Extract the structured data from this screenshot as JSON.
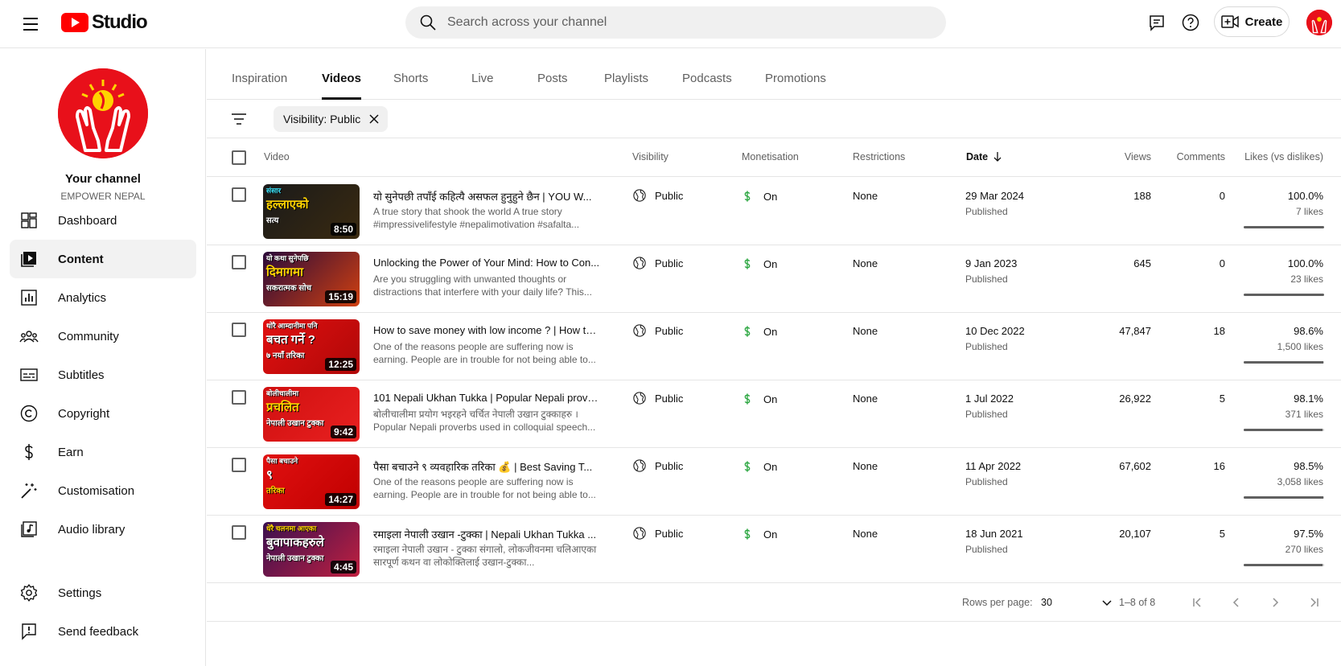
{
  "header": {
    "logo_text": "Studio",
    "search_placeholder": "Search across your channel",
    "create_label": "Create"
  },
  "sidebar": {
    "channel_title": "Your channel",
    "channel_name": "EMPOWER NEPAL",
    "items": [
      {
        "label": "Dashboard",
        "icon": "dashboard-icon"
      },
      {
        "label": "Content",
        "icon": "content-icon",
        "active": true
      },
      {
        "label": "Analytics",
        "icon": "analytics-icon"
      },
      {
        "label": "Community",
        "icon": "community-icon"
      },
      {
        "label": "Subtitles",
        "icon": "subtitles-icon"
      },
      {
        "label": "Copyright",
        "icon": "copyright-icon"
      },
      {
        "label": "Earn",
        "icon": "dollar-icon"
      },
      {
        "label": "Customisation",
        "icon": "magic-wand-icon"
      },
      {
        "label": "Audio library",
        "icon": "audio-library-icon"
      },
      {
        "label": "Settings",
        "icon": "gear-icon"
      },
      {
        "label": "Send feedback",
        "icon": "feedback-icon"
      }
    ]
  },
  "tabs": [
    "Inspiration",
    "Videos",
    "Shorts",
    "Live",
    "Posts",
    "Playlists",
    "Podcasts",
    "Promotions"
  ],
  "active_tab": "Videos",
  "filter": {
    "chip_label": "Visibility: Public"
  },
  "table": {
    "headers": {
      "video": "Video",
      "visibility": "Visibility",
      "monetisation": "Monetisation",
      "restrictions": "Restrictions",
      "date": "Date",
      "views": "Views",
      "comments": "Comments",
      "likes": "Likes (vs dislikes)"
    },
    "rows": [
      {
        "title": "यो सुनेपछी तपाँई कहित्यै असफल हुनुहुने छैन | YOU W...",
        "desc": "A true story that shook the world A true story #impressivelifestyle #nepalimotivation #safalta...",
        "duration": "8:50",
        "visibility": "Public",
        "monetisation": "On",
        "restrictions": "None",
        "date": "29 Mar 2024",
        "status": "Published",
        "views": "188",
        "comments": "0",
        "likes_pct": "100.0%",
        "likes_count": "7 likes",
        "likes_ratio": 1.0
      },
      {
        "title": "Unlocking the Power of Your Mind: How to Con...",
        "desc": "Are you struggling with unwanted thoughts or distractions that interfere with your daily life? This...",
        "duration": "15:19",
        "visibility": "Public",
        "monetisation": "On",
        "restrictions": "None",
        "date": "9 Jan 2023",
        "status": "Published",
        "views": "645",
        "comments": "0",
        "likes_pct": "100.0%",
        "likes_count": "23 likes",
        "likes_ratio": 1.0
      },
      {
        "title": "How to save money with low income ? | How to...",
        "desc": "One of the reasons people are suffering now is earning. People are in trouble for not being able to...",
        "duration": "12:25",
        "visibility": "Public",
        "monetisation": "On",
        "restrictions": "None",
        "date": "10 Dec 2022",
        "status": "Published",
        "views": "47,847",
        "comments": "18",
        "likes_pct": "98.6%",
        "likes_count": "1,500 likes",
        "likes_ratio": 0.986
      },
      {
        "title": "101 Nepali Ukhan Tukka | Popular Nepali prove...",
        "desc": "बोलीचालीमा प्रयोग भइरहने चर्चित नेपाली उखान टुक्काहरु । Popular Nepali proverbs used in colloquial speech...",
        "duration": "9:42",
        "visibility": "Public",
        "monetisation": "On",
        "restrictions": "None",
        "date": "1 Jul 2022",
        "status": "Published",
        "views": "26,922",
        "comments": "5",
        "likes_pct": "98.1%",
        "likes_count": "371 likes",
        "likes_ratio": 0.981
      },
      {
        "title": "पैसा बचाउने ९ व्यवहारिक तरिका 💰 | Best Saving T...",
        "desc": "One of the reasons people are suffering now is earning. People are in trouble for not being able to...",
        "duration": "14:27",
        "visibility": "Public",
        "monetisation": "On",
        "restrictions": "None",
        "date": "11 Apr 2022",
        "status": "Published",
        "views": "67,602",
        "comments": "16",
        "likes_pct": "98.5%",
        "likes_count": "3,058 likes",
        "likes_ratio": 0.985
      },
      {
        "title": "रमाइला नेपाली उखान -टुक्का | Nepali Ukhan Tukka ...",
        "desc": "रमाइला नेपाली उखान - टुक्का संगालो, लोकजीवनमा चलिआएका सारपूर्ण कथन वा लोकोक्तिलाई उखान-टुक्का...",
        "duration": "4:45",
        "visibility": "Public",
        "monetisation": "On",
        "restrictions": "None",
        "date": "18 Jun 2021",
        "status": "Published",
        "views": "20,107",
        "comments": "5",
        "likes_pct": "97.5%",
        "likes_count": "270 likes",
        "likes_ratio": 0.975
      }
    ]
  },
  "thumbnails": [
    {
      "bg": "linear-gradient(135deg,#1a1a1a,#3a2a10)",
      "lines": [
        "संसार",
        "हल्लाएको",
        "सत्य"
      ],
      "colors": [
        "#3ee8ff",
        "#ffd400",
        "#ffffff"
      ]
    },
    {
      "bg": "linear-gradient(135deg,#2a0a3a,#d04010)",
      "lines": [
        "यो कथा सुनेपछि",
        "दिमागमा",
        "सकरात्मक सोच"
      ],
      "colors": [
        "#ffffff",
        "#ffd400",
        "#ffffff"
      ]
    },
    {
      "bg": "linear-gradient(135deg,#e01010,#b00808)",
      "lines": [
        "थोरै आम्दानीमा पनि",
        "बचत गर्ने ?",
        "७ नयाँ तरिका"
      ],
      "colors": [
        "#ffffff",
        "#ffffff",
        "#ffffff"
      ]
    },
    {
      "bg": "linear-gradient(135deg,#d01010,#e82020)",
      "lines": [
        "बोलीचालीमा",
        "प्रचलित",
        "नेपाली उखान टुक्का"
      ],
      "colors": [
        "#ffffff",
        "#ffd400",
        "#ffffff"
      ]
    },
    {
      "bg": "linear-gradient(135deg,#e01010,#c00000)",
      "lines": [
        "पैसा बचाउने",
        "९",
        "तरिका"
      ],
      "colors": [
        "#ffffff",
        "#ffffff",
        "#ffd400"
      ]
    },
    {
      "bg": "linear-gradient(135deg,#3a1050,#c02040)",
      "lines": [
        "धेरै चलनमा आएका",
        "बुवापाकहरुले",
        "नेपाली उखान टुक्का"
      ],
      "colors": [
        "#ffd400",
        "#ffffff",
        "#ffffff"
      ]
    }
  ],
  "pagination": {
    "rows_per_page_label": "Rows per page:",
    "rows_per_page": "30",
    "range": "1–8 of 8"
  },
  "colors": {
    "brand_red": "#ff0000",
    "monetisation_green": "#2ba640",
    "muted_text": "#606060"
  }
}
